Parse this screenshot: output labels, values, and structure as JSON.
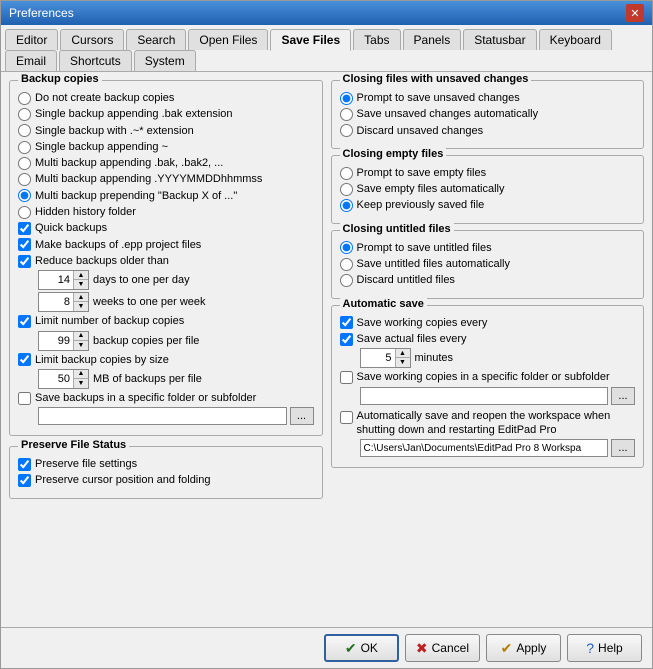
{
  "window": {
    "title": "Preferences",
    "close_label": "✕"
  },
  "tabs": [
    {
      "label": "Editor",
      "active": false
    },
    {
      "label": "Cursors",
      "active": false
    },
    {
      "label": "Search",
      "active": false
    },
    {
      "label": "Open Files",
      "active": false
    },
    {
      "label": "Save Files",
      "active": true
    },
    {
      "label": "Tabs",
      "active": false
    },
    {
      "label": "Panels",
      "active": false
    },
    {
      "label": "Statusbar",
      "active": false
    },
    {
      "label": "Keyboard",
      "active": false
    },
    {
      "label": "Email",
      "active": false
    },
    {
      "label": "Shortcuts",
      "active": false
    },
    {
      "label": "System",
      "active": false
    }
  ],
  "left": {
    "backup_copies": {
      "title": "Backup copies",
      "options": [
        {
          "label": "Do not create backup copies",
          "checked": false
        },
        {
          "label": "Single backup appending .bak extension",
          "checked": false
        },
        {
          "label": "Single backup with .~* extension",
          "checked": false
        },
        {
          "label": "Single backup appending ~",
          "checked": false
        },
        {
          "label": "Multi backup appending .bak, .bak2, ...",
          "checked": false
        },
        {
          "label": "Multi backup appending .YYYYMMDDhhmmss",
          "checked": false
        },
        {
          "label": "Multi backup prepending \"Backup X of ...\"",
          "checked": true
        },
        {
          "label": "Hidden history folder",
          "checked": false
        }
      ],
      "checkboxes": [
        {
          "label": "Quick backups",
          "checked": true
        },
        {
          "label": "Make backups of .epp project files",
          "checked": true
        }
      ],
      "reduce": {
        "label": "Reduce backups older than",
        "checked": true,
        "days_val": "14",
        "days_label": "days to one per day",
        "weeks_val": "8",
        "weeks_label": "weeks to one per week"
      },
      "limit_num": {
        "label": "Limit number of backup copies",
        "checked": true,
        "val": "99",
        "suffix": "backup copies per file"
      },
      "limit_size": {
        "label": "Limit backup copies by size",
        "checked": true,
        "val": "50",
        "suffix": "MB of backups per file"
      },
      "specific_folder": {
        "label": "Save backups in a specific folder or subfolder",
        "checked": false,
        "placeholder": ""
      }
    },
    "preserve": {
      "title": "Preserve File Status",
      "items": [
        {
          "label": "Preserve file settings",
          "checked": true
        },
        {
          "label": "Preserve cursor position and folding",
          "checked": true
        }
      ]
    }
  },
  "right": {
    "closing_unsaved": {
      "title": "Closing files with unsaved changes",
      "options": [
        {
          "label": "Prompt to save unsaved changes",
          "checked": true
        },
        {
          "label": "Save unsaved changes automatically",
          "checked": false
        },
        {
          "label": "Discard unsaved changes",
          "checked": false
        }
      ]
    },
    "closing_empty": {
      "title": "Closing empty files",
      "options": [
        {
          "label": "Prompt to save empty files",
          "checked": false
        },
        {
          "label": "Save empty files automatically",
          "checked": false
        },
        {
          "label": "Keep previously saved file",
          "checked": true
        }
      ]
    },
    "closing_untitled": {
      "title": "Closing untitled files",
      "options": [
        {
          "label": "Prompt to save untitled files",
          "checked": true
        },
        {
          "label": "Save untitled files automatically",
          "checked": false
        },
        {
          "label": "Discard untitled files",
          "checked": false
        }
      ]
    },
    "auto_save": {
      "title": "Automatic save",
      "save_working": {
        "label": "Save working copies every",
        "checked": true
      },
      "save_actual": {
        "label": "Save actual files every",
        "checked": true
      },
      "minutes_val": "5",
      "minutes_label": "minutes",
      "specific_folder": {
        "label": "Save working copies in a specific folder or subfolder",
        "checked": false,
        "placeholder": ""
      },
      "reopen": {
        "label": "Automatically save and reopen the workspace when shutting down and restarting EditPad Pro",
        "checked": false,
        "path": "C:\\Users\\Jan\\Documents\\EditPad Pro 8 Workspa"
      }
    }
  },
  "footer": {
    "ok_label": "OK",
    "cancel_label": "Cancel",
    "apply_label": "Apply",
    "help_label": "Help"
  }
}
